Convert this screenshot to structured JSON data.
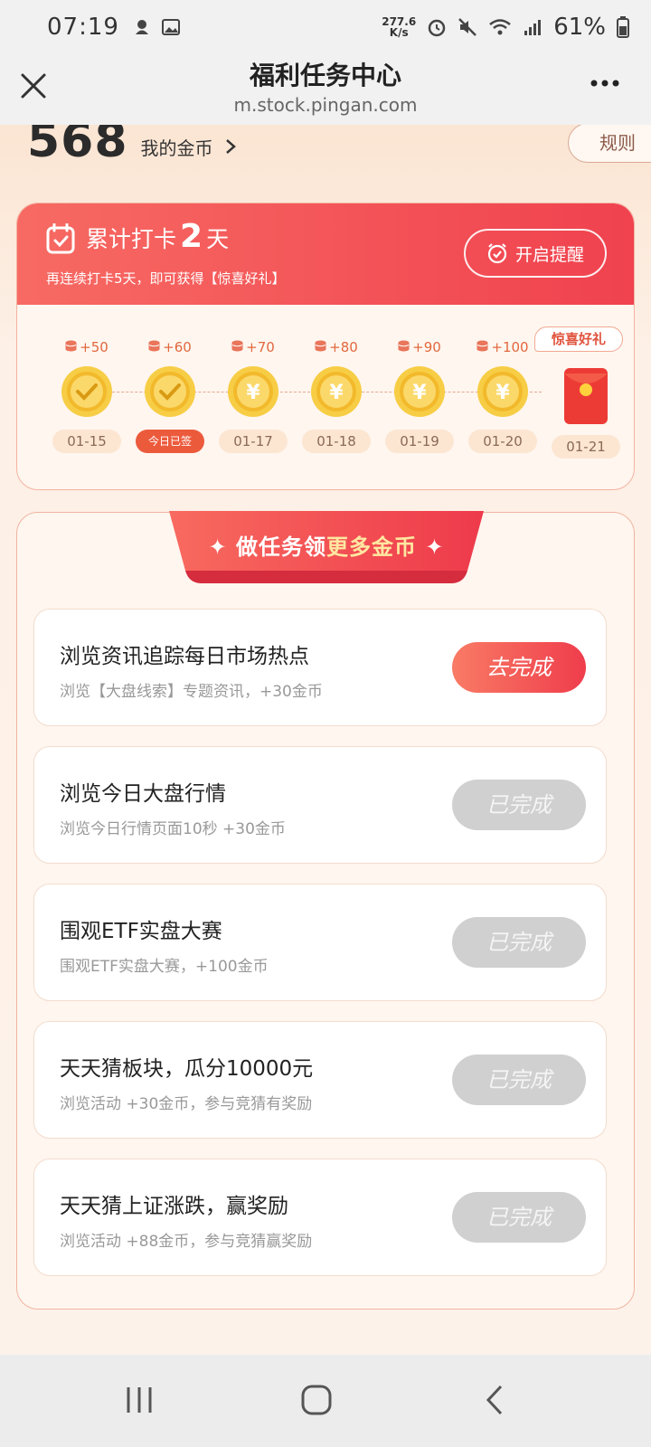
{
  "status_bar": {
    "time": "07:19",
    "net_speed_value": "277.6",
    "net_speed_unit": "K/s",
    "battery": "61%",
    "icons": [
      "notification-icon",
      "gallery-icon",
      "alarm-icon",
      "mute-icon",
      "wifi-icon",
      "signal-icon",
      "battery-icon"
    ]
  },
  "titlebar": {
    "title": "福利任务中心",
    "url": "m.stock.pingan.com"
  },
  "coins": {
    "count": "568",
    "label": "我的金币"
  },
  "rules_label": "规则",
  "checkin": {
    "prefix": "累计打卡",
    "days": "2",
    "suffix": "天",
    "subtitle": "再连续打卡5天，即可获得【惊喜好礼】",
    "remind_label": "开启提醒",
    "surprise_label": "惊喜好礼",
    "items": [
      {
        "reward": "+50",
        "date": "01-15",
        "state": "checked"
      },
      {
        "reward": "+60",
        "date": "今日已签",
        "state": "checked-today"
      },
      {
        "reward": "+70",
        "date": "01-17",
        "state": "coin"
      },
      {
        "reward": "+80",
        "date": "01-18",
        "state": "coin"
      },
      {
        "reward": "+90",
        "date": "01-19",
        "state": "coin"
      },
      {
        "reward": "+100",
        "date": "01-20",
        "state": "coin"
      },
      {
        "reward": "",
        "date": "01-21",
        "state": "gift"
      }
    ]
  },
  "tasks": {
    "banner_part1": "做任务领",
    "banner_part2": "更多金币",
    "items": [
      {
        "title": "浏览资讯追踪每日市场热点",
        "desc": "浏览【大盘线索】专题资讯，+30金币",
        "button": "去完成",
        "status": "todo"
      },
      {
        "title": "浏览今日大盘行情",
        "desc": "浏览今日行情页面10秒 +30金币",
        "button": "已完成",
        "status": "done"
      },
      {
        "title": "围观ETF实盘大赛",
        "desc": "围观ETF实盘大赛，+100金币",
        "button": "已完成",
        "status": "done"
      },
      {
        "title": "天天猜板块，瓜分10000元",
        "desc": "浏览活动 +30金币，参与竞猜有奖励",
        "button": "已完成",
        "status": "done"
      },
      {
        "title": "天天猜上证涨跌，赢奖励",
        "desc": "浏览活动 +88金币，参与竞猜赢奖励",
        "button": "已完成",
        "status": "done"
      }
    ]
  },
  "colors": {
    "accent": "#f0424f",
    "done_button": "#d0d0d0",
    "coin_gold": "#f5c536"
  }
}
